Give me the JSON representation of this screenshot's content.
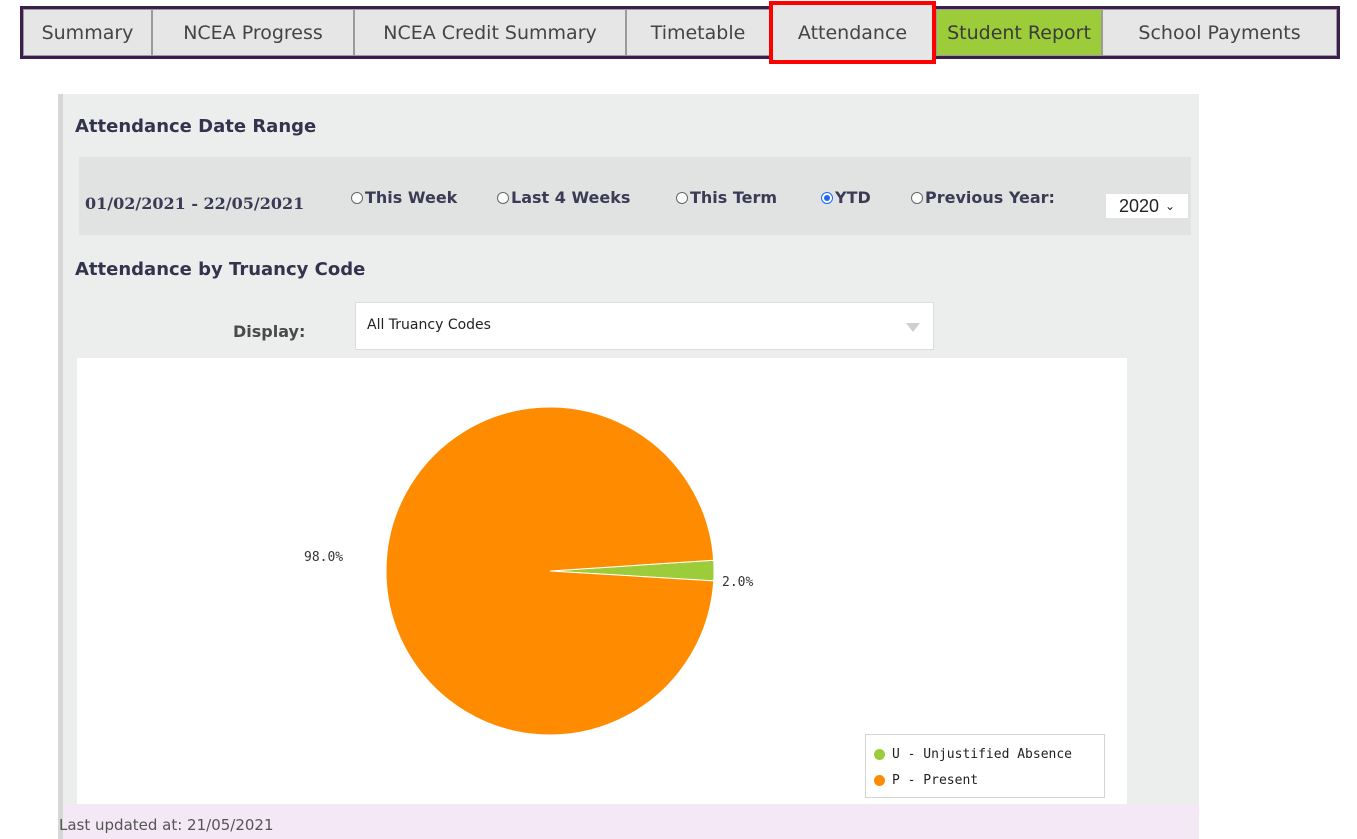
{
  "tabs": [
    {
      "label": "Summary"
    },
    {
      "label": "NCEA Progress"
    },
    {
      "label": "NCEA Credit Summary"
    },
    {
      "label": "Timetable"
    },
    {
      "label": "Attendance"
    },
    {
      "label": "Student Report"
    },
    {
      "label": "School Payments"
    }
  ],
  "date_range": {
    "heading": "Attendance Date Range",
    "dates": "01/02/2021 - 22/05/2021",
    "options": [
      {
        "label": "This Week",
        "selected": false
      },
      {
        "label": "Last 4 Weeks",
        "selected": false
      },
      {
        "label": "This Term",
        "selected": false
      },
      {
        "label": "YTD",
        "selected": true
      },
      {
        "label": "Previous Year:",
        "selected": false
      }
    ],
    "year_value": "2020"
  },
  "truancy": {
    "heading": "Attendance by Truancy Code",
    "display_label": "Display:",
    "display_value": "All Truancy Codes"
  },
  "chart_data": {
    "type": "pie",
    "series": [
      {
        "name": "U - Unjustified Absence",
        "value": 2.0,
        "label": "2.0%",
        "color": "#9ccc3a"
      },
      {
        "name": "P - Present",
        "value": 98.0,
        "label": "98.0%",
        "color": "#ff8c00"
      }
    ],
    "legend": "bottom-right"
  },
  "footer": {
    "text": "Last updated at: 21/05/2021"
  }
}
